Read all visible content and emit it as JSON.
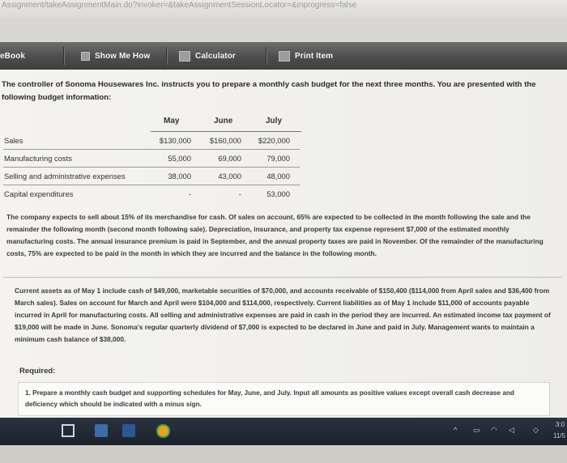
{
  "url": "Assignment/takeAssignmentMain.do?invoker=&takeAssignmentSessionLocator=&inprogress=false",
  "toolbar": {
    "ebook": "eBook",
    "show_me_how": "Show Me How",
    "calculator": "Calculator",
    "print_item": "Print Item"
  },
  "intro": "The controller of Sonoma Housewares Inc. instructs you to prepare a monthly cash budget for the next three months. You are presented with the following budget information:",
  "budget": {
    "months": [
      "May",
      "June",
      "July"
    ],
    "rows": [
      {
        "label": "Sales",
        "values": [
          "$130,000",
          "$160,000",
          "$220,000"
        ]
      },
      {
        "label": "Manufacturing costs",
        "values": [
          "55,000",
          "69,000",
          "79,000"
        ]
      },
      {
        "label": "Selling and administrative expenses",
        "values": [
          "38,000",
          "43,000",
          "48,000"
        ]
      },
      {
        "label": "Capital expenditures",
        "values": [
          "-",
          "-",
          "53,000"
        ]
      }
    ]
  },
  "para1": "The company expects to sell about 15% of its merchandise for cash. Of sales on account, 65% are expected to be collected in the month following the sale and the remainder the following month (second month following sale). Depreciation, insurance, and property tax expense represent $7,000 of the estimated monthly manufacturing costs. The annual insurance premium is paid in September, and the annual property taxes are paid in November. Of the remainder of the manufacturing costs, 75% are expected to be paid in the month in which they are incurred and the balance in the following month.",
  "para2": "Current assets as of May 1 include cash of $49,000, marketable securities of $70,000, and accounts receivable of $150,400 ($114,000 from April sales and $36,400 from March sales). Sales on account for March and April were $104,000 and $114,000, respectively. Current liabilities as of May 1 include $11,000 of accounts payable incurred in April for manufacturing costs. All selling and administrative expenses are paid in cash in the period they are incurred. An estimated income tax payment of $19,000 will be made in June. Sonoma's regular quarterly dividend of $7,000 is expected to be declared in June and paid in July. Management wants to maintain a minimum cash balance of $38,000.",
  "required_label": "Required:",
  "required_item": "1. Prepare a monthly cash budget and supporting schedules for May, June, and July. Input all amounts as positive values except overall cash decrease and deficiency which should be indicated with a minus sign.",
  "tray": {
    "time": "3:0",
    "date": "11/5"
  },
  "colors": {
    "toolbar": "#4d4d4d",
    "taskbar": "#1b222c",
    "page": "#f2f1ee"
  }
}
